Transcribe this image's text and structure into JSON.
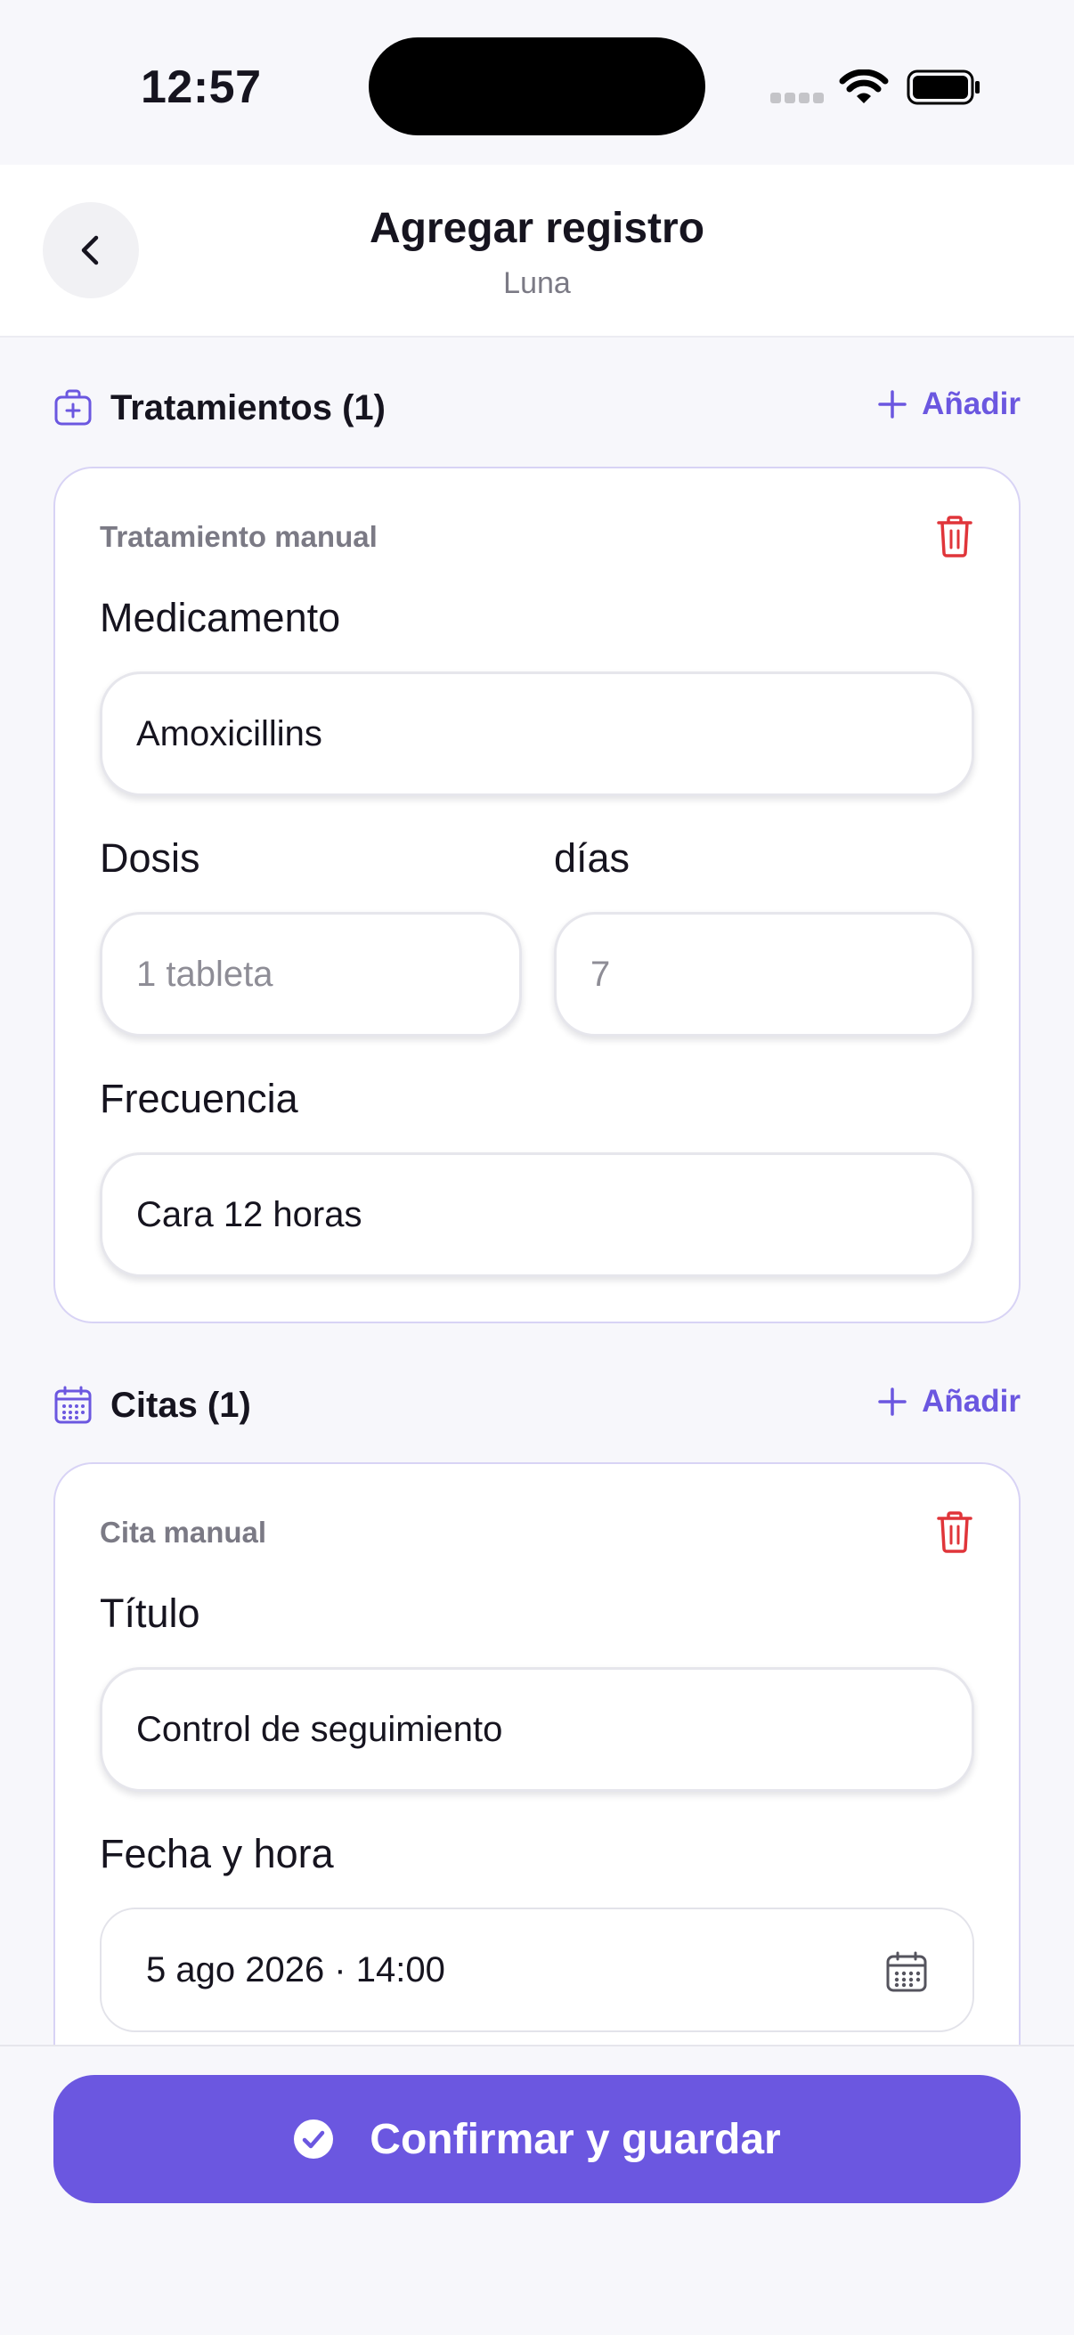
{
  "status_bar": {
    "time": "12:57"
  },
  "header": {
    "title": "Agregar registro",
    "subtitle": "Luna"
  },
  "treatments": {
    "title": "Tratamientos (1)",
    "add_label": "Añadir",
    "card": {
      "label": "Tratamiento manual",
      "medicamento_label": "Medicamento",
      "medicamento_value": "Amoxicillins",
      "dosis_label": "Dosis",
      "dosis_placeholder": "1 tableta",
      "dias_label": "días",
      "dias_placeholder": "7",
      "frecuencia_label": "Frecuencia",
      "frecuencia_value": "Cara 12 horas"
    }
  },
  "appointments": {
    "title": "Citas (1)",
    "add_label": "Añadir",
    "card": {
      "label": "Cita manual",
      "titulo_label": "Título",
      "titulo_value": "Control de seguimiento",
      "fecha_label": "Fecha y hora",
      "fecha_value": "5 ago 2026 · 14:00"
    }
  },
  "footer": {
    "confirm_label": "Confirmar y guardar"
  },
  "colors": {
    "accent": "#6b57e0",
    "danger": "#e0353a",
    "card_border": "#d8d3f5"
  },
  "icons": {
    "back": "chevron-left-icon",
    "treatments": "medical-kit-icon",
    "appointments": "calendar-icon",
    "add": "plus-icon",
    "delete": "trash-icon",
    "date_picker": "calendar-icon",
    "confirm": "check-circle-icon"
  }
}
